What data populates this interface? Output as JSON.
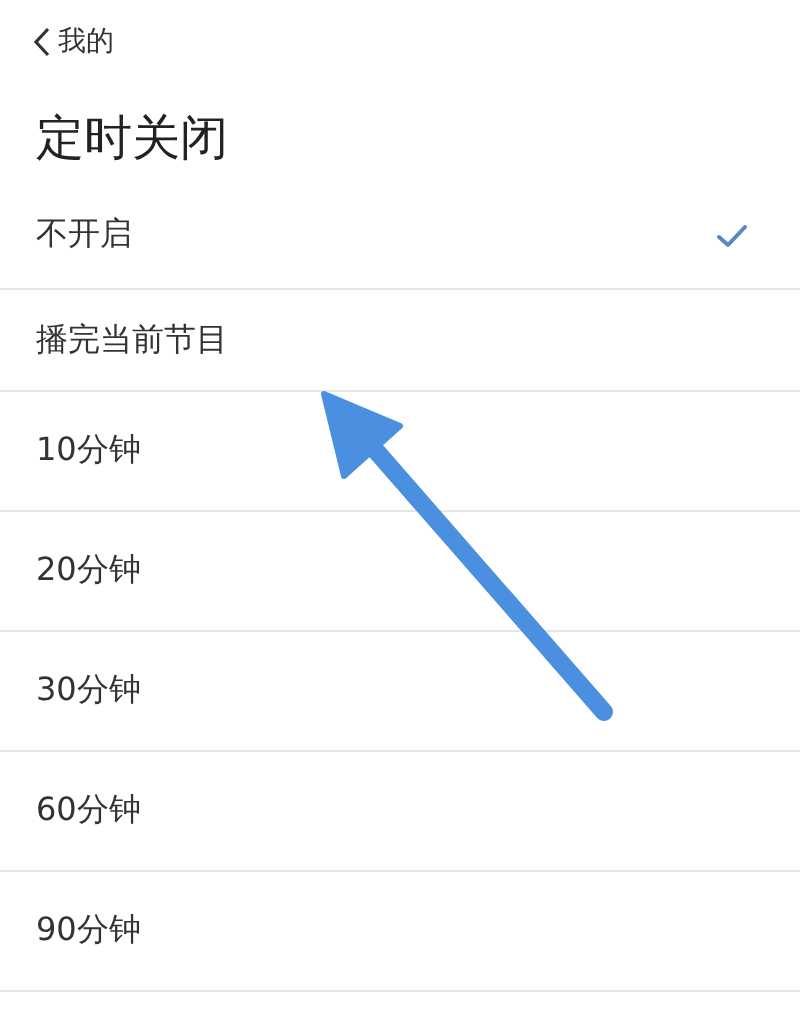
{
  "nav": {
    "back_label": "我的"
  },
  "title": "定时关闭",
  "options": [
    {
      "label": "不开启",
      "selected": true
    },
    {
      "label": "播完当前节目",
      "selected": false
    },
    {
      "label": "10分钟",
      "selected": false
    },
    {
      "label": "20分钟",
      "selected": false
    },
    {
      "label": "30分钟",
      "selected": false
    },
    {
      "label": "60分钟",
      "selected": false
    },
    {
      "label": "90分钟",
      "selected": false
    }
  ]
}
